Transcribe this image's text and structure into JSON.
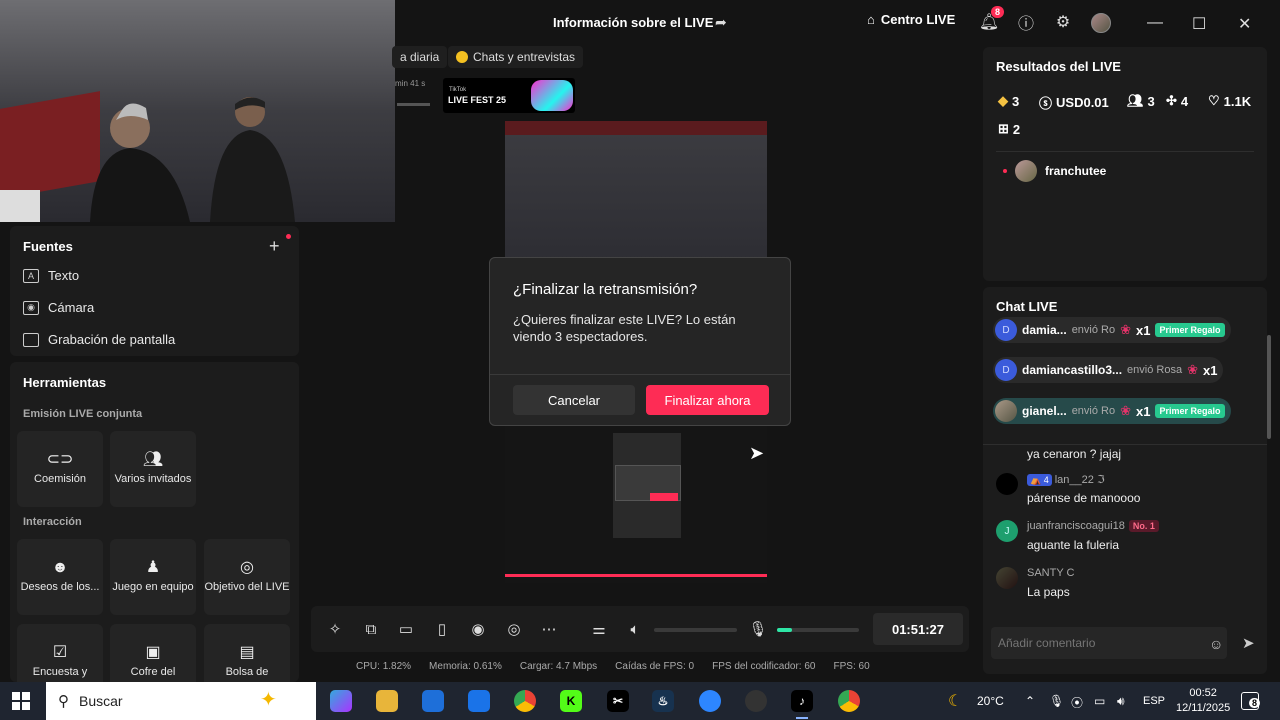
{
  "titlebar": {
    "title": "Información sobre el LIVE",
    "centro_label": "Centro LIVE",
    "notif_count": "8"
  },
  "chips": [
    {
      "label": "a diaria"
    },
    {
      "label": "Chats y entrevistas"
    }
  ],
  "timer_small": "min 41 s",
  "livefest": {
    "brand": "TikTok",
    "name": "LIVE FEST 25"
  },
  "fuentes": {
    "title": "Fuentes",
    "items": [
      {
        "label": "Texto",
        "icon": "text-icon"
      },
      {
        "label": "Cámara",
        "icon": "camera-icon"
      },
      {
        "label": "Grabación de pantalla",
        "icon": "monitor-icon"
      }
    ]
  },
  "herramientas": {
    "title": "Herramientas",
    "sec1": "Emisión LIVE conjunta",
    "sec2": "Interacción",
    "tools": [
      {
        "label": "Coemisión",
        "icon": "link-icon"
      },
      {
        "label": "Varios invitados",
        "icon": "users-icon"
      },
      {
        "label": "Deseos de los...",
        "icon": "wishes-icon"
      },
      {
        "label": "Juego en equipo",
        "icon": "team-game-icon"
      },
      {
        "label": "Objetivo del LIVE",
        "icon": "target-icon"
      },
      {
        "label": "Encuesta y",
        "icon": "poll-icon"
      },
      {
        "label": "Cofre del",
        "icon": "chest-icon"
      },
      {
        "label": "Bolsa de",
        "icon": "bag-icon"
      }
    ]
  },
  "modal": {
    "title": "¿Finalizar la retransmisión?",
    "body": "¿Quieres finalizar este LIVE? Lo están viendo 3 espectadores.",
    "cancel": "Cancelar",
    "confirm": "Finalizar ahora"
  },
  "controls": {
    "time": "01:51:27",
    "mic_level": 0.18
  },
  "stats": [
    {
      "label": "CPU:",
      "value": "1.82%"
    },
    {
      "label": "Memoria:",
      "value": "0.61%"
    },
    {
      "label": "Cargar:",
      "value": "4.7 Mbps"
    },
    {
      "label": "Caídas de FPS:",
      "value": "0"
    },
    {
      "label": "FPS del codificador:",
      "value": "60"
    },
    {
      "label": "FPS:",
      "value": "60"
    }
  ],
  "results": {
    "title": "Resultados del LIVE",
    "diamonds": "3",
    "usd": "USD0.01",
    "viewers": "3",
    "shares": "4",
    "likes": "1.1K",
    "gifts": "2",
    "top_user": "franchutee"
  },
  "chat": {
    "title": "Chat LIVE",
    "gifts": [
      {
        "user": "damia...",
        "sent": "envió Ro",
        "count": "x1",
        "badge": "Primer Regalo",
        "avatar": "D"
      },
      {
        "user": "damiancastillo3...",
        "sent": "envió Rosa",
        "count": "x1",
        "badge": "",
        "avatar": "D"
      },
      {
        "user": "gianel...",
        "sent": "envió Ro",
        "count": "x1",
        "badge": "Primer Regalo",
        "avatar": ""
      }
    ],
    "partial_text": "ya cenaron ? jajaj",
    "messages": [
      {
        "level": "4",
        "user": "lan__22",
        "text": "párense de manoooo",
        "badge": ""
      },
      {
        "level": "",
        "user": "juanfranciscoagui18",
        "text": "aguante la fuleria",
        "badge": "No. 1"
      },
      {
        "level": "",
        "user": "SANTY C",
        "text": "La paps",
        "badge": ""
      }
    ],
    "placeholder": "Añadir comentario"
  },
  "taskbar": {
    "search": "Buscar",
    "weather": "20°C",
    "lang": "ESP",
    "time": "00:52",
    "date": "12/11/2025",
    "notif": "8"
  }
}
